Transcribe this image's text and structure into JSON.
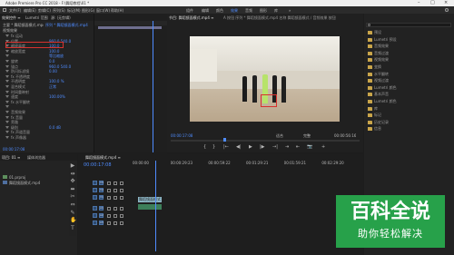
{
  "window": {
    "title": "Adobe Premiere Pro CC 2018 - F:\\舞蹈教程\\01 *",
    "controls": [
      "–",
      "□",
      "×"
    ]
  },
  "menubar": {
    "items": [
      "文件(F)",
      "编辑(E)",
      "剪辑(C)",
      "序列(S)",
      "标记(M)",
      "图形(G)",
      "窗口(W)",
      "帮助(H)"
    ]
  },
  "workspaces": {
    "items": [
      "组件",
      "编辑",
      "颜色",
      "效果",
      "音频",
      "图形",
      "库"
    ],
    "active": "效果",
    "more": "»"
  },
  "effect_controls": {
    "tabs": [
      "效果控件 ≡",
      "Lumetri 范围",
      "源: (无剪辑)",
      "音频剪辑混合器: 01"
    ],
    "source_label": "主要 * 舞蹈镜面模式.mp4",
    "sequence_label": "序列 * 舞蹈镜面模式.mp4",
    "section_video": "视频效果",
    "rows": [
      {
        "label": "fx 运动",
        "value": ""
      },
      {
        "label": "位置",
        "value": "960.0  540.0"
      },
      {
        "label": "缩放高度",
        "value": "100.0"
      },
      {
        "label": "缩放宽度",
        "value": "100.0"
      },
      {
        "label": "",
        "value": "等比缩放"
      },
      {
        "label": "旋转",
        "value": "0.0"
      },
      {
        "label": "锚点",
        "value": "960.0  540.0"
      },
      {
        "label": "防闪烁滤镜",
        "value": "0.00"
      },
      {
        "label": "fx 不透明度",
        "value": ""
      },
      {
        "label": "不透明度",
        "value": "100.0 %"
      },
      {
        "label": "混合模式",
        "value": "正常"
      },
      {
        "label": "时间重映射",
        "value": ""
      },
      {
        "label": "速度",
        "value": "100.00%"
      },
      {
        "label": "fx 水平翻转",
        "value": ""
      },
      {
        "label": "",
        "value": ""
      },
      {
        "label": "音频效果",
        "value": ""
      },
      {
        "label": "fx 音量",
        "value": ""
      },
      {
        "label": "旁路",
        "value": ""
      },
      {
        "label": "级别",
        "value": "0.0 dB"
      },
      {
        "label": "fx 声道音量",
        "value": ""
      },
      {
        "label": "fx 声像器",
        "value": ""
      }
    ],
    "timecode": "00:00:17:08"
  },
  "project": {
    "tabs": [
      "项目: 01 ≡",
      "媒体浏览器"
    ],
    "items": [
      "01.prproj",
      "舞蹈镜面模式.mp4"
    ]
  },
  "tools": [
    "▶",
    "⇹",
    "✥",
    "⬌",
    "✂",
    "⇔",
    "✎",
    "✋",
    "T"
  ],
  "program_monitor": {
    "title": "节目: 舞蹈镜面模式.mp4 ≡",
    "header_extra": "A 按钮   序列 * 舞蹈镜面模式.mp4   名称 舞蹈镜面模式 / 音频效果 按钮",
    "timecode_left": "00:00:17:08",
    "fit": "适合",
    "quality": "完整",
    "timecode_right": "00:00:56:16",
    "controls": [
      "{",
      "}",
      "|←",
      "◀|",
      "▶",
      "|▶",
      "→|",
      "⇥",
      "⇤",
      "📷",
      "+"
    ]
  },
  "timeline": {
    "tab": "舞蹈镜面模式.mp4 ≡",
    "timecode": "00:00:17:08",
    "ruler": [
      "00:00:00",
      "00:00:29:23",
      "00:00:59:22",
      "00:01:29:21",
      "00:01:59:21",
      "00:02:29:20"
    ],
    "video_tracks": [
      "V3",
      "V2",
      "V1"
    ],
    "audio_tracks": [
      "A1",
      "A2",
      "A3"
    ],
    "clip_label": "舞蹈镜面模式.mp4"
  },
  "right_panel": {
    "search": "",
    "items": [
      "预设",
      "Lumetri 预设",
      "音频效果",
      "音频过渡",
      "视频效果",
      "变换",
      "水平翻转",
      "视频过渡",
      "Lumetri 颜色",
      "基本声音",
      "Lumetri 颜色",
      "库",
      "标记",
      "历史记录",
      "信息"
    ]
  },
  "watermark": {
    "title": "百科全说",
    "subtitle": "助你轻松解决"
  },
  "colors": {
    "accent": "#4f8cff",
    "clip": "#8fb9c9",
    "audio_clip": "#3d7f5a",
    "highlight_box": "#d8322e",
    "watermark_bg": "#27a14a"
  }
}
